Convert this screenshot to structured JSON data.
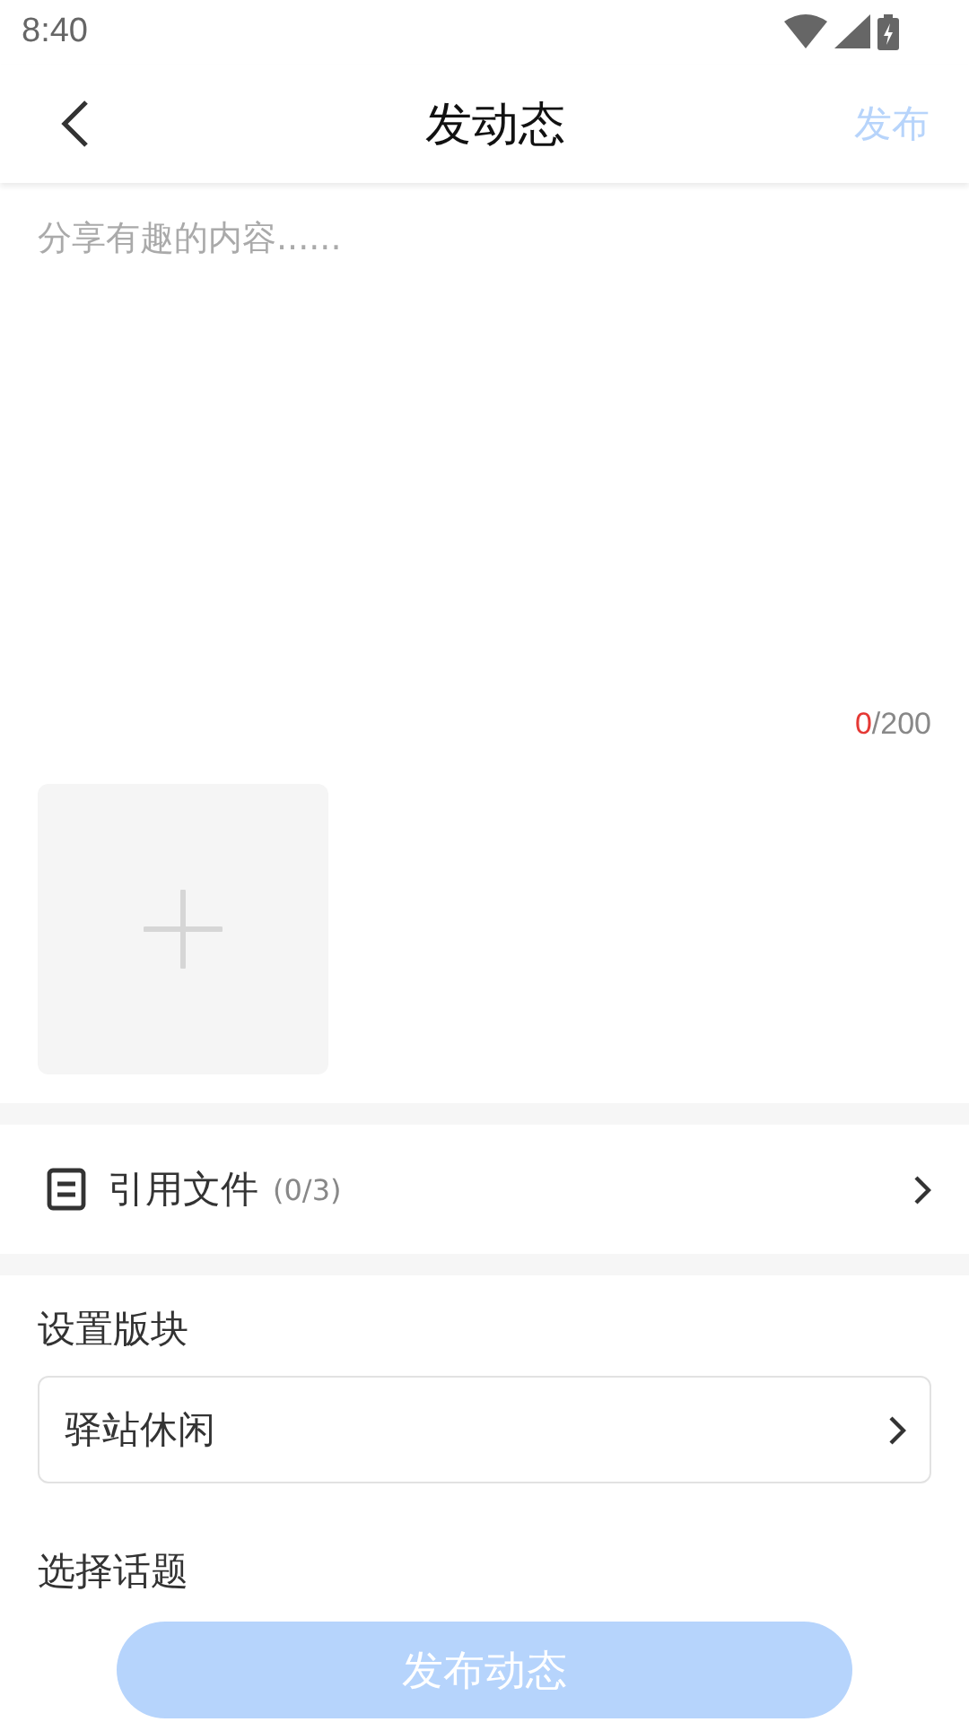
{
  "status_bar": {
    "time": "8:40"
  },
  "header": {
    "title": "发动态",
    "publish": {
      "label": "发布",
      "disabled": true
    }
  },
  "editor": {
    "placeholder": "分享有趣的内容......",
    "count": "0",
    "limit": "/200"
  },
  "attachments": {
    "kind": "add"
  },
  "file_row": {
    "label": "引用文件",
    "count": "(0/3)"
  },
  "board": {
    "label": "设置版块",
    "value": "驿站休闲"
  },
  "topic": {
    "label": "选择话题"
  },
  "submit": {
    "label": "发布动态",
    "disabled": true
  }
}
